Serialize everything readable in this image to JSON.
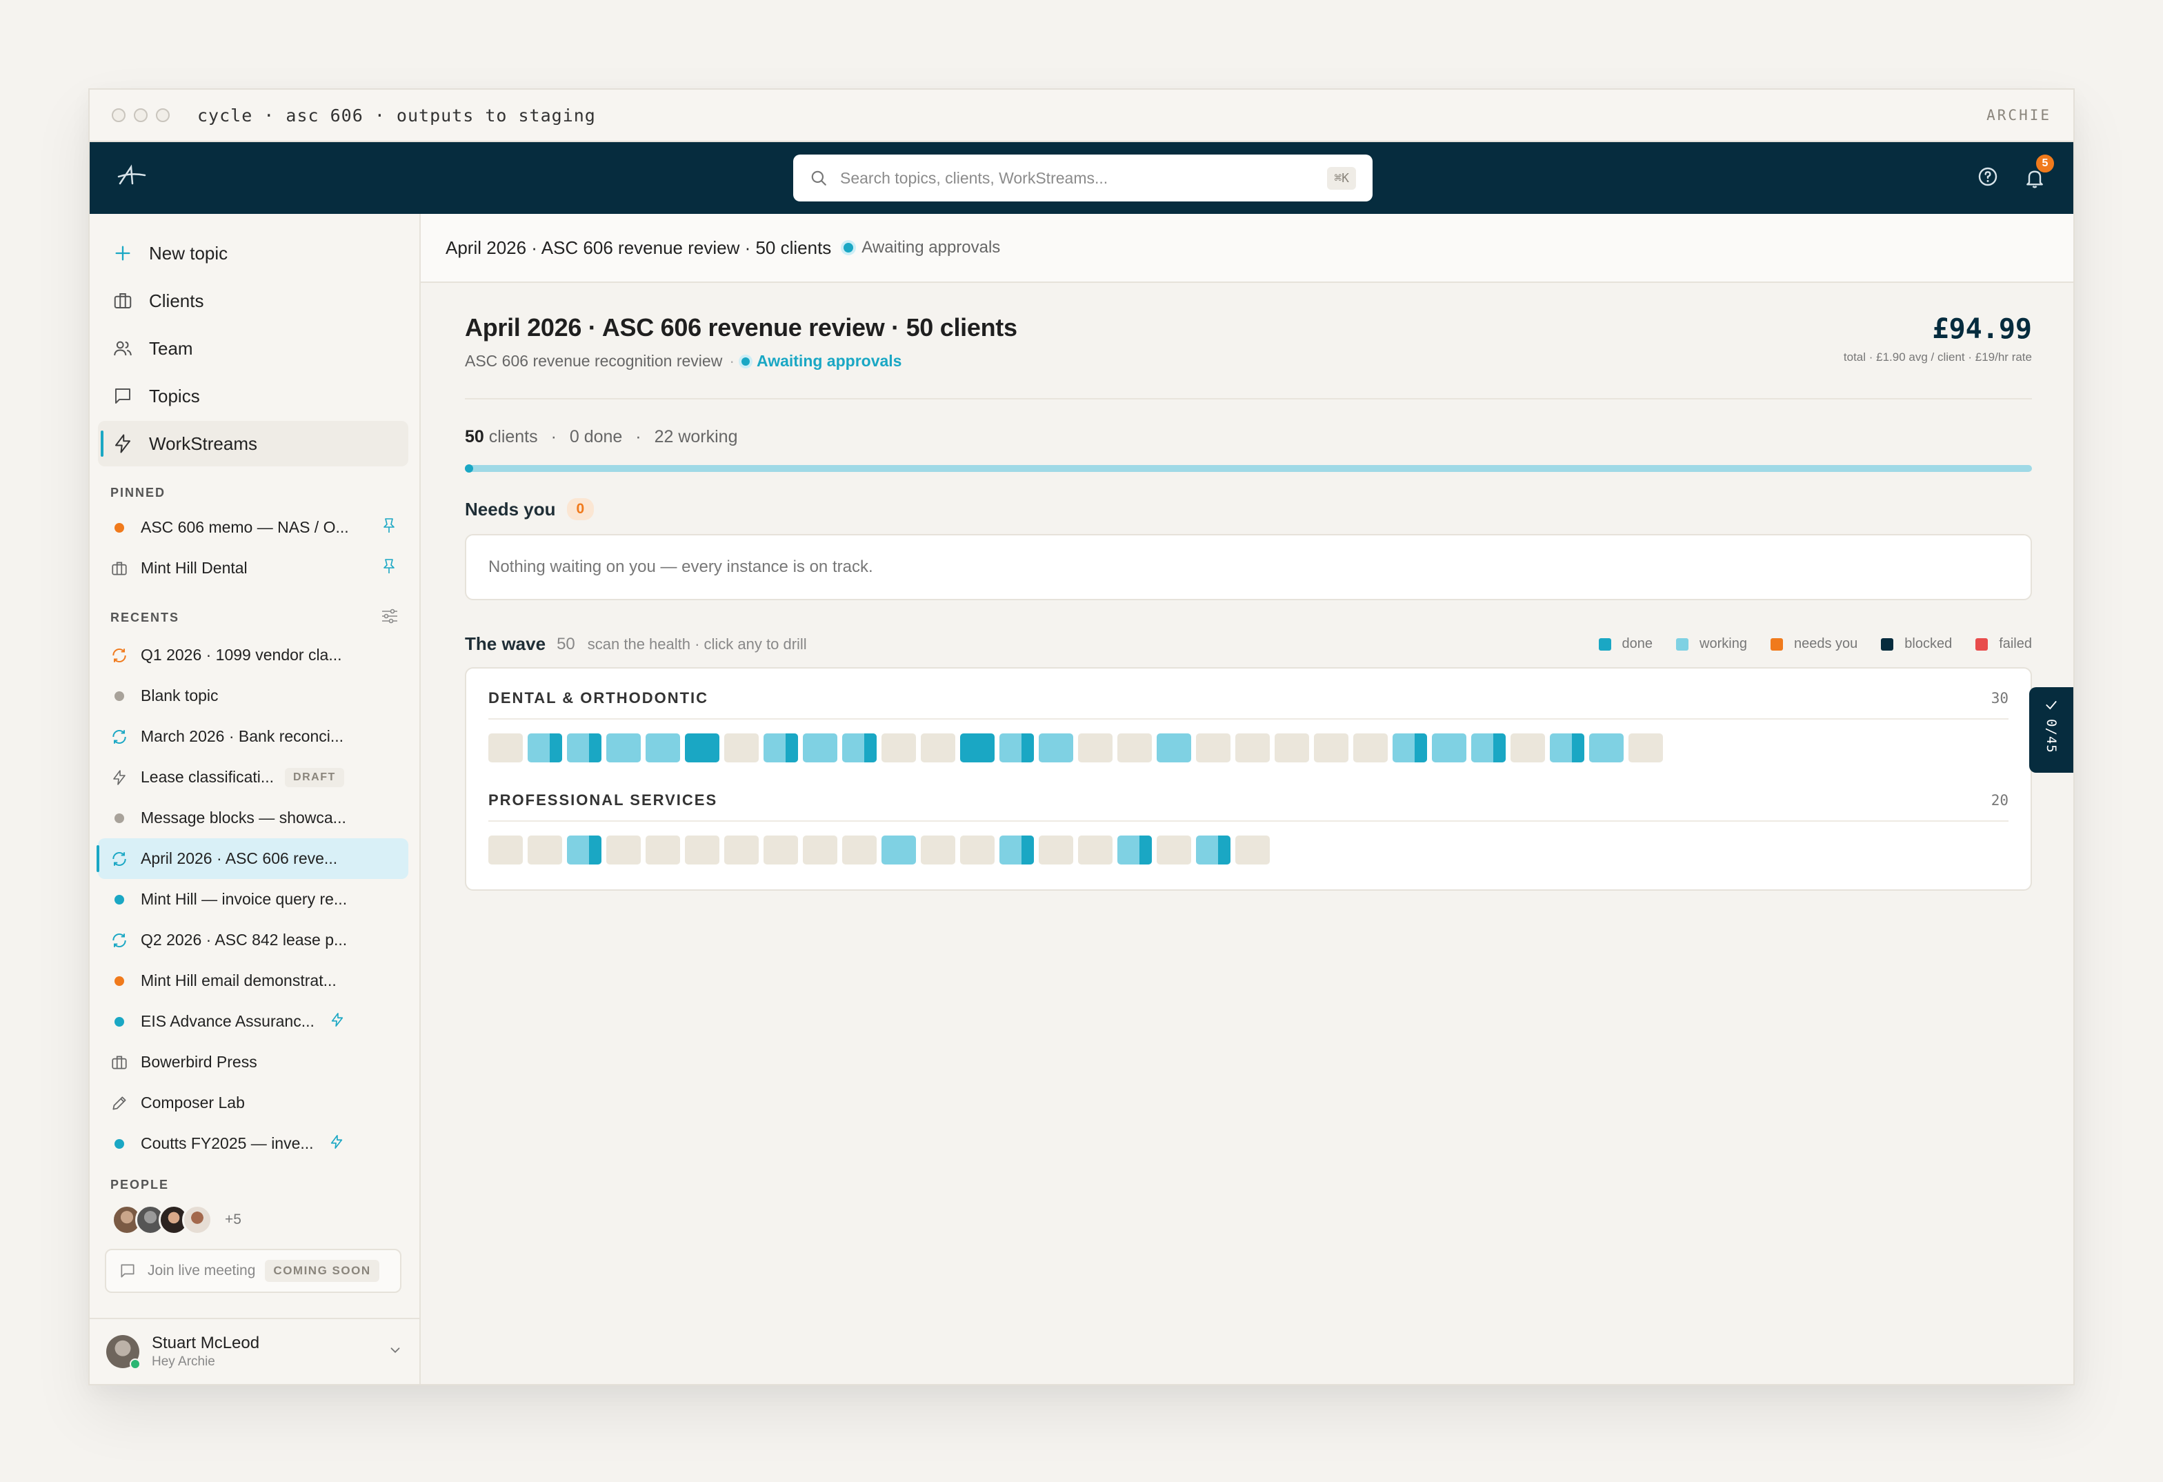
{
  "window": {
    "title": "cycle · asc 606 · outputs to staging",
    "brand": "ARCHIE"
  },
  "topbar": {
    "logo": "A",
    "search_placeholder": "Search topics, clients, WorkStreams...",
    "search_shortcut": "⌘K",
    "notification_count": "5"
  },
  "sidebar": {
    "nav": [
      {
        "label": "New topic",
        "icon": "plus-icon"
      },
      {
        "label": "Clients",
        "icon": "briefcase-icon"
      },
      {
        "label": "Team",
        "icon": "users-icon"
      },
      {
        "label": "Topics",
        "icon": "chat-icon"
      },
      {
        "label": "WorkStreams",
        "icon": "bolt-icon"
      }
    ],
    "pinned_label": "PINNED",
    "pinned": [
      {
        "label": "ASC 606 memo — NAS / O...",
        "icon": "orange-dot"
      },
      {
        "label": "Mint Hill Dental",
        "icon": "briefcase-icon"
      }
    ],
    "recents_label": "RECENTS",
    "recents": [
      {
        "label": "Q1 2026 · 1099 vendor cla...",
        "icon": "sync-orange-icon"
      },
      {
        "label": "Blank topic",
        "icon": "grey-dot"
      },
      {
        "label": "March 2026 · Bank reconci...",
        "icon": "sync-icon"
      },
      {
        "label": "Lease classificati...",
        "icon": "bolt-icon",
        "badge": "DRAFT"
      },
      {
        "label": "Message blocks — showca...",
        "icon": "grey-dot"
      },
      {
        "label": "April 2026 · ASC 606 reve...",
        "icon": "sync-icon"
      },
      {
        "label": "Mint Hill — invoice query re...",
        "icon": "teal-dot"
      },
      {
        "label": "Q2 2026 · ASC 842 lease p...",
        "icon": "sync-icon"
      },
      {
        "label": "Mint Hill email demonstrat...",
        "icon": "orange-dot"
      },
      {
        "label": "EIS Advance Assuranc...",
        "icon": "teal-dot"
      },
      {
        "label": "Bowerbird Press",
        "icon": "briefcase-icon"
      },
      {
        "label": "Composer Lab",
        "icon": "pencil-icon"
      },
      {
        "label": "Coutts FY2025 — inve...",
        "icon": "teal-dot"
      }
    ],
    "people_label": "PEOPLE",
    "people_more": "+5",
    "meeting_label": "Join live meeting",
    "meeting_badge": "COMING SOON",
    "user": {
      "name": "Stuart McLeod",
      "subtitle": "Hey Archie"
    }
  },
  "main": {
    "breadcrumb": "April 2026 · ASC 606 revenue review · 50 clients",
    "breadcrumb_status": "Awaiting approvals",
    "title": "April 2026 · ASC 606 revenue review · 50 clients",
    "subtitle": "ASC 606 revenue recognition review",
    "subtitle_sep": "·",
    "status": "Awaiting approvals",
    "price": "£94.99",
    "price_sub": "total · £1.90 avg / client · £19/hr rate",
    "stats": {
      "clients_num": "50",
      "clients_label": "clients",
      "done": "0 done",
      "working": "22 working"
    },
    "progress": 0.005,
    "needs_you": {
      "title": "Needs you",
      "count": "0",
      "empty": "Nothing waiting on you — every instance is on track."
    },
    "wave": {
      "title": "The wave",
      "count": "50",
      "hint": "scan the health · click any to drill",
      "legend": [
        {
          "label": "done",
          "color": "#1aa7c4"
        },
        {
          "label": "working",
          "color": "#7fd1e3"
        },
        {
          "label": "needs you",
          "color": "#f07a1c"
        },
        {
          "label": "blocked",
          "color": "#062c3e"
        },
        {
          "label": "failed",
          "color": "#e84c4c"
        }
      ],
      "groups": [
        {
          "name": "DENTAL & ORTHODONTIC",
          "count": "30",
          "cells": [
            "queued",
            "half",
            "half",
            "working",
            "working",
            "done",
            "queued",
            "half",
            "working",
            "half",
            "queued",
            "queued",
            "done",
            "half",
            "working",
            "queued",
            "queued",
            "working",
            "queued",
            "queued",
            "queued",
            "queued",
            "queued",
            "half",
            "working",
            "half",
            "queued",
            "half",
            "working",
            "queued"
          ]
        },
        {
          "name": "PROFESSIONAL SERVICES",
          "count": "20",
          "cells": [
            "queued",
            "queued",
            "half",
            "queued",
            "queued",
            "queued",
            "queued",
            "queued",
            "queued",
            "queued",
            "working",
            "queued",
            "queued",
            "half",
            "queued",
            "queued",
            "half",
            "queued",
            "half",
            "queued"
          ]
        }
      ]
    },
    "side_tab": "0/45"
  }
}
